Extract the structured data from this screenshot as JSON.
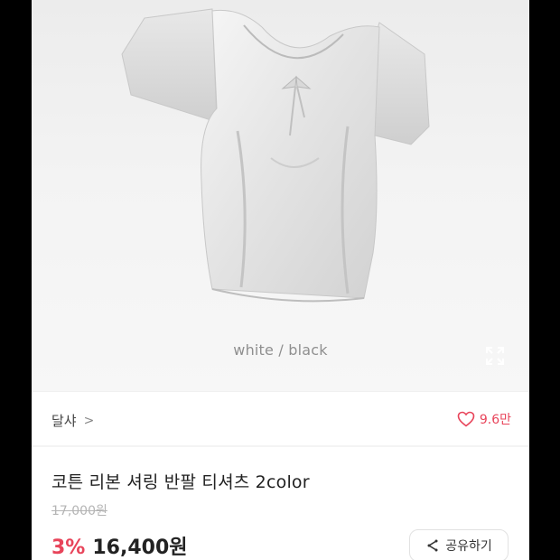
{
  "product": {
    "image_caption": "white / black",
    "title": "코튼 리본 셔링 반팔 티셔츠 2color",
    "original_price": "17,000원",
    "discount": "3%",
    "price": "16,400원"
  },
  "shop": {
    "name": "달샤",
    "chevron": ">"
  },
  "likes": {
    "count": "9.6만"
  },
  "actions": {
    "share_label": "공유하기"
  },
  "colors": {
    "accent": "#e8445a",
    "text": "#222222",
    "muted": "#b5b5b5"
  }
}
